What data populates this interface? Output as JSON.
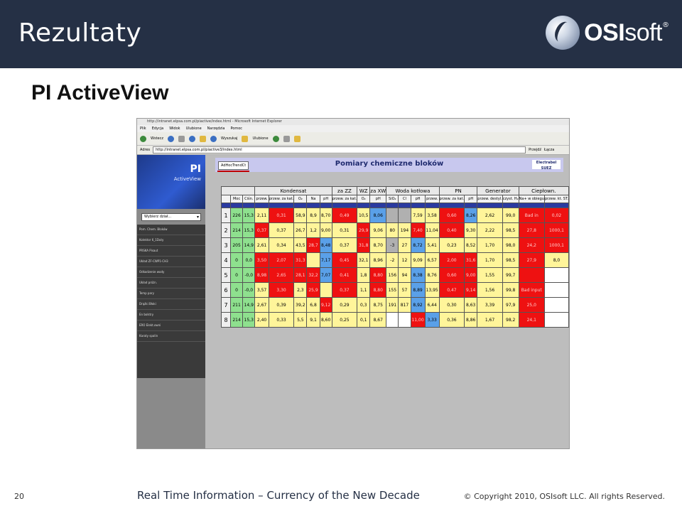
{
  "slide": {
    "title": "Rezultaty",
    "subtitle": "PI ActiveView",
    "logo_brand": "OSI",
    "logo_brand_suffix": "soft",
    "logo_mark": "®",
    "page_number": "20",
    "tagline": "Real Time Information – Currency of the New Decade",
    "copyright": "© Copyright 2010, OSIsoft LLC.  All rights Reserved.",
    "colors": {
      "header_bg": "#253045",
      "accent": "#c00000"
    }
  },
  "browser": {
    "title_text": "http://intranet.elpsa.com.pl/piactive/index.html - Microsoft Internet Explorer",
    "menu": [
      "Plik",
      "Edycja",
      "Widok",
      "Ulubione",
      "Narzędzia",
      "Pomoc"
    ],
    "toolbar": {
      "back": "Wstecz",
      "search": "Wyszukaj",
      "favorites": "Ulubione"
    },
    "address_label": "Adres",
    "address_value": "http://intranet.elpsa.com.pl/piactive3/index.html",
    "go_label": "Przejdź",
    "links_label": "Łącza"
  },
  "pi_sidebar": {
    "logo": "PI",
    "product": "ActiveView",
    "select_value": "Wybierz dział...",
    "items": [
      "Pom. Chem. Bloków",
      "Kolektor 6_1Duty",
      "PRSKA Pisaut",
      "Układ ZF-CWP1-CH3",
      "Odkodzenie wody",
      "Układ próżn.",
      "Temp pary",
      "Drążki Błoki",
      "En bolstry",
      "ERO Elekt.owni",
      "Karaty spalin"
    ]
  },
  "page": {
    "trend_button": "AdHocTrendCt",
    "title": "Pomiary chemiczne bloków",
    "partner_logo": "Electrabel",
    "partner_logo_sub": "SUEZ"
  },
  "table": {
    "groups": [
      "",
      "Kondensat",
      "za ZZ",
      "WZ",
      "za XW",
      "Woda kotłowa",
      "PN",
      "Generator",
      "Ciepłown."
    ],
    "sub_headers": [
      "Moc",
      "Ciśn.",
      "przew.",
      "przew. za kat.",
      "O₂",
      "Na",
      "pH",
      "przew. za kat.",
      "O₂",
      "pH",
      "SiO₂",
      "Cl",
      "pH",
      "przew.",
      "przew. za kat.",
      "pH",
      "przew. destyl.",
      "czyst. H₂",
      "Na+ w obiegu",
      "przew. kt. ST."
    ],
    "rows": [
      {
        "id": "1",
        "cells": [
          "226",
          "15,3",
          "2,11",
          "0,31",
          "58,9",
          "8,9",
          "8,70",
          "0,49",
          "10,5",
          "8,06",
          "",
          "",
          "7,59",
          "3,58",
          "0,60",
          "8,26",
          "2,62",
          "99,0",
          "Bad in",
          "0,02"
        ]
      },
      {
        "id": "2",
        "cells": [
          "214",
          "15,3",
          "0,37",
          "0,37",
          "26,7",
          "1,2",
          "9,00",
          "0,31",
          "29,9",
          "9,06",
          "80",
          "194",
          "7,40",
          "11,04",
          "0,40",
          "9,30",
          "2,22",
          "98,5",
          "27,8",
          "1000,1"
        ]
      },
      {
        "id": "3",
        "cells": [
          "205",
          "14,9",
          "2,61",
          "0,34",
          "43,5",
          "28,7",
          "8,48",
          "0,37",
          "31,8",
          "8,70",
          "-3",
          "27",
          "8,72",
          "5,41",
          "0,23",
          "8,52",
          "1,70",
          "98,0",
          "24,2",
          "1000,1"
        ]
      },
      {
        "id": "4",
        "cells": [
          "0",
          "0,0",
          "3,50",
          "2,07",
          "31,3",
          "",
          "7,17",
          "0,45",
          "32,1",
          "8,96",
          "-2",
          "12",
          "9,09",
          "6,57",
          "2,00",
          "31,6",
          "1,70",
          "98,5",
          "27,9",
          "8,0"
        ]
      },
      {
        "id": "5",
        "cells": [
          "0",
          "-0,0",
          "8,98",
          "2,65",
          "28,1",
          "32,2",
          "7,07",
          "0,41",
          "1,8",
          "8,80",
          "156",
          "94",
          "8,38",
          "8,76",
          "0,60",
          "9,00",
          "1,55",
          "99,7",
          "",
          ""
        ]
      },
      {
        "id": "6",
        "cells": [
          "0",
          "-0,0",
          "3,57",
          "3,30",
          "2,3",
          "25,9",
          "",
          "0,37",
          "1,1",
          "8,80",
          "155",
          "57",
          "8,89",
          "13,95",
          "0,47",
          "9,14",
          "1,56",
          "99,8",
          "Bad input",
          ""
        ]
      },
      {
        "id": "7",
        "cells": [
          "211",
          "14,9",
          "2,67",
          "0,39",
          "39,2",
          "6,8",
          "9,12",
          "0,29",
          "0,3",
          "8,75",
          "191",
          "817",
          "8,92",
          "6,44",
          "0,30",
          "8,63",
          "3,39",
          "97,9",
          "25,0",
          ""
        ]
      },
      {
        "id": "8",
        "cells": [
          "214",
          "15,3",
          "2,40",
          "0,33",
          "5,5",
          "9,1",
          "8,60",
          "0,25",
          "0,1",
          "8,67",
          "",
          "",
          "11,00",
          "3,33",
          "0,36",
          "8,86",
          "1,67",
          "98,2",
          "24,1",
          ""
        ]
      }
    ]
  }
}
